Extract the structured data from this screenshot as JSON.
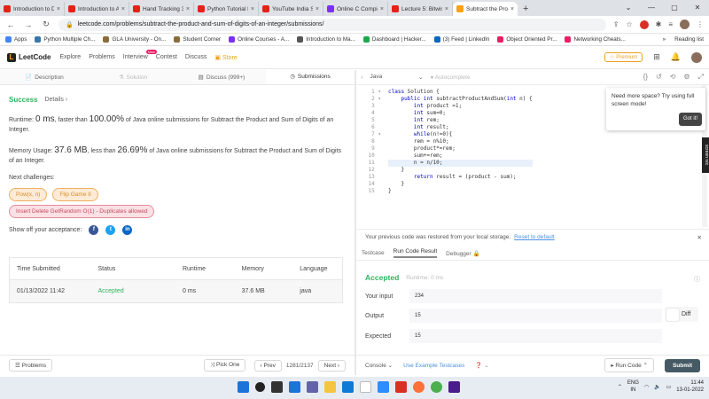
{
  "browser": {
    "tabs": [
      {
        "title": "Introduction to Da",
        "color": "#e62117"
      },
      {
        "title": "Introduction to AI",
        "color": "#e62117"
      },
      {
        "title": "Hand Tracking 30",
        "color": "#e62117"
      },
      {
        "title": "Python Tutorial F",
        "color": "#e62117"
      },
      {
        "title": "YouTube India St",
        "color": "#e62117"
      },
      {
        "title": "Online C Compile",
        "color": "#7b2ff7"
      },
      {
        "title": "Lecture 5: Bitwise",
        "color": "#e62117"
      },
      {
        "title": "Subtract the Prod",
        "color": "#ffa116"
      }
    ],
    "url": "leetcode.com/problems/subtract-the-product-and-sum-of-digits-of-an-integer/submissions/",
    "bookmarks": [
      {
        "label": "Apps",
        "color": "#4285f4"
      },
      {
        "label": "Python Multiple Ch...",
        "color": "#3776ab"
      },
      {
        "label": "GLA University - On...",
        "color": "#8a6d3b"
      },
      {
        "label": "Student Corner",
        "color": "#8a6d3b"
      },
      {
        "label": "Online Courses - A...",
        "color": "#7b2ff7"
      },
      {
        "label": "Introduction to Ma...",
        "color": "#555555"
      },
      {
        "label": "Dashboard | Hacker...",
        "color": "#1ba94c"
      },
      {
        "label": "(3) Feed | LinkedIn",
        "color": "#0a66c2"
      },
      {
        "label": "Object Oriented Pr...",
        "color": "#e91e63"
      },
      {
        "label": "Networking Cheats...",
        "color": "#e91e63"
      }
    ],
    "reading_list": "Reading list",
    "more": "»"
  },
  "lc": {
    "logo": "LeetCode",
    "nav": [
      "Explore",
      "Problems",
      "Interview",
      "Contest",
      "Discuss"
    ],
    "new_badge": "New",
    "store": "Store",
    "premium": "Premium"
  },
  "left_tabs": [
    {
      "label": "Description",
      "icon": "📄"
    },
    {
      "label": "Solution",
      "icon": "⚗"
    },
    {
      "label": "Discuss (999+)",
      "icon": "▤"
    },
    {
      "label": "Submissions",
      "icon": "◷"
    }
  ],
  "result": {
    "status": "Success",
    "details": "Details",
    "details_arrow": "›",
    "runtime_prefix": "Runtime: ",
    "runtime_value": "0 ms",
    "runtime_mid": ", faster than ",
    "runtime_pct": "100.00%",
    "runtime_suffix": " of Java online submissions for Subtract the Product and Sum of Digits of an Integer.",
    "memory_prefix": "Memory Usage: ",
    "memory_value": "37.6 MB",
    "memory_mid": ", less than ",
    "memory_pct": "26.69%",
    "memory_suffix": " of Java online submissions for Subtract the Product and Sum of Digits of an Integer.",
    "next_label": "Next challenges:",
    "challenges": [
      "Pow(x, n)",
      "Flip Game II",
      "Insert Delete GetRandom O(1) - Duplicates allowed"
    ],
    "share_label": "Show off your acceptance:"
  },
  "table": {
    "headers": [
      "Time Submitted",
      "Status",
      "Runtime",
      "Memory",
      "Language"
    ],
    "rows": [
      [
        "01/13/2022 11:42",
        "Accepted",
        "0 ms",
        "37.6 MB",
        "java"
      ]
    ]
  },
  "left_footer": {
    "problems": "Problems",
    "pick_one": "Pick One",
    "prev": "Prev",
    "page": "1281/2137",
    "next": "Next"
  },
  "editor": {
    "language": "Java",
    "autocomplete": "Autocomplete",
    "gutter_marks": [
      "▾",
      "▾",
      "",
      "",
      "",
      "",
      "▾",
      "",
      "",
      "",
      "",
      "",
      "",
      "",
      ""
    ],
    "lines": [
      "class Solution {",
      "    public int subtractProductAndSum(int n) {",
      "        int product =1;",
      "        int sum=0;",
      "        int rem;",
      "        int result;",
      "        while(n!=0){",
      "        rem = n%10;",
      "        product*=rem;",
      "        sum+=rem;",
      "        n = n/10;",
      "    }",
      "        return result = (product - sum);",
      "    }",
      "}"
    ],
    "tooltip_text": "Need more space? Try using full screen mode!",
    "tooltip_btn": "Got it!",
    "side_badge": "screen rec"
  },
  "restored": {
    "text": "Your previous code was restored from your local storage.",
    "link": "Reset to default"
  },
  "result_tabs": [
    "Testcase",
    "Run Code Result",
    "Debugger"
  ],
  "run": {
    "status": "Accepted",
    "runtime": "Runtime: 0 ms",
    "your_input_label": "Your input",
    "your_input": "234",
    "output_label": "Output",
    "output": "15",
    "expected_label": "Expected",
    "expected": "15",
    "diff": "Diff"
  },
  "right_footer": {
    "console": "Console",
    "use_example": "Use Example Testcases",
    "run_code": "Run Code",
    "submit": "Submit"
  },
  "taskbar": {
    "lang1": "ENG",
    "lang2": "IN",
    "time": "11:44",
    "date": "13-01-2022"
  }
}
